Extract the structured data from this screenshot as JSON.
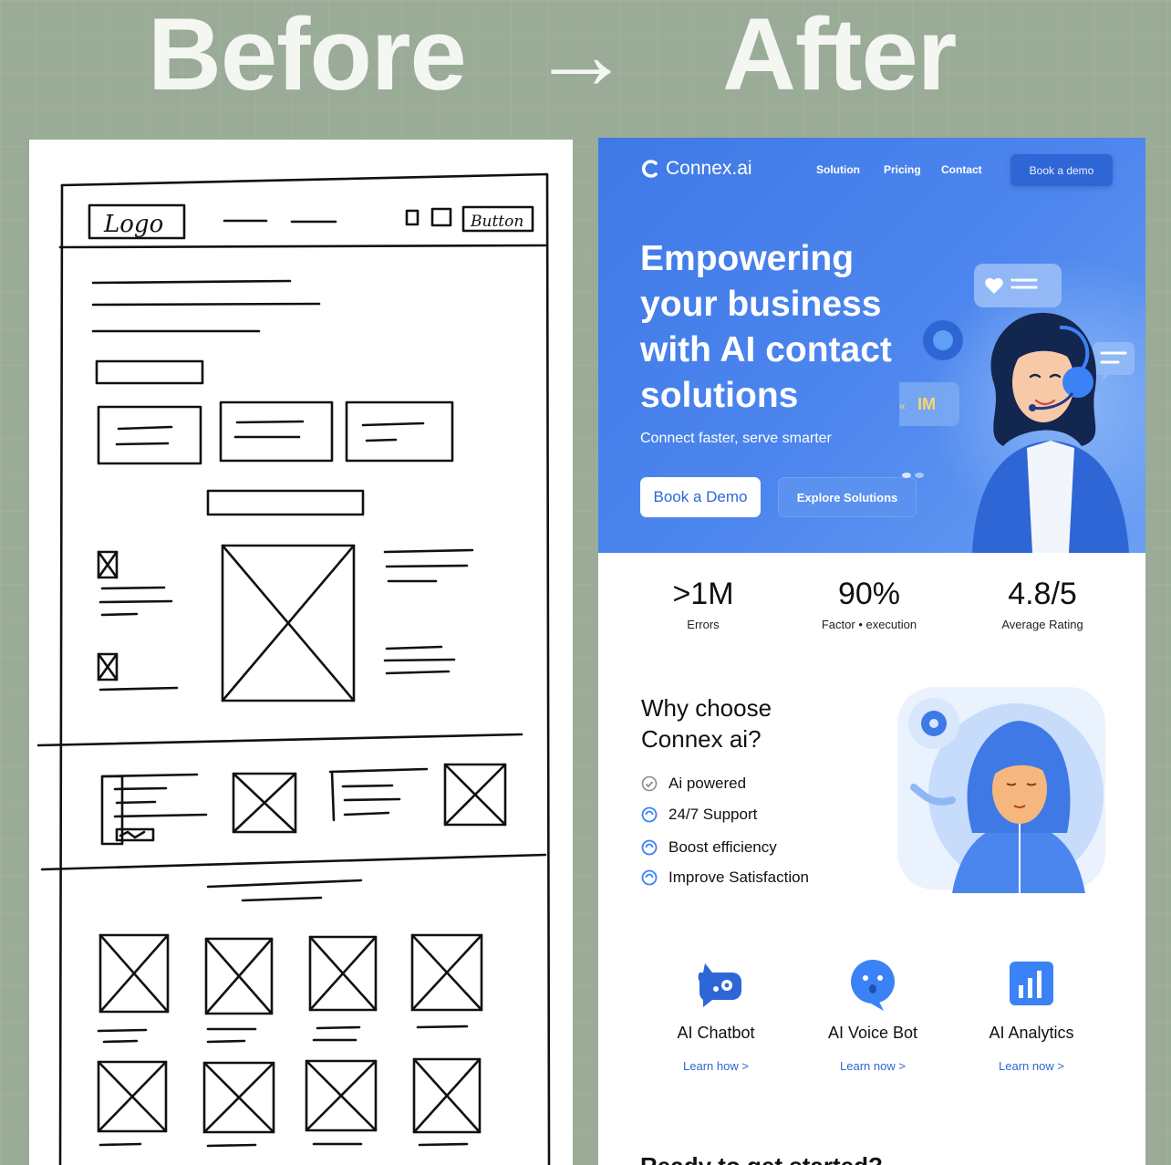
{
  "heading": {
    "before": "Before",
    "arrow": "→",
    "after": "After"
  },
  "sketch": {
    "logo_label": "Logo",
    "button_label": "Button"
  },
  "nav": {
    "brand": "Connex.ai",
    "links": [
      "Solution",
      "Pricing",
      "Contact"
    ],
    "cta": "Book a demo"
  },
  "hero": {
    "title": "Empowering your business with AI contact solutions",
    "subtitle": "Connect faster, serve smarter",
    "primary_button": "Book a Demo",
    "secondary_button": "Explore Solutions",
    "bubble_text": "IM"
  },
  "stats": [
    {
      "value": ">1M",
      "label": "Errors"
    },
    {
      "value": "90%",
      "label": "Factor • execution"
    },
    {
      "value": "4.8/5",
      "label": "Average Rating"
    }
  ],
  "why": {
    "title": "Why choose Connex ai?",
    "features": [
      "Ai powered",
      "24/7 Support",
      "Boost efficiency",
      "Improve Satisfaction"
    ]
  },
  "products": [
    {
      "name": "AI Chatbot",
      "link": "Learn how >",
      "icon": "chatbot-icon"
    },
    {
      "name": "AI Voice Bot",
      "link": "Learn now >",
      "icon": "voice-bot-icon"
    },
    {
      "name": "AI Analytics",
      "link": "Learn now >",
      "icon": "analytics-icon"
    }
  ],
  "cta_peek": "Ready to get started?",
  "colors": {
    "brand_blue": "#3f79e6",
    "link_blue": "#2f66d6",
    "backdrop": "#9aab97"
  }
}
